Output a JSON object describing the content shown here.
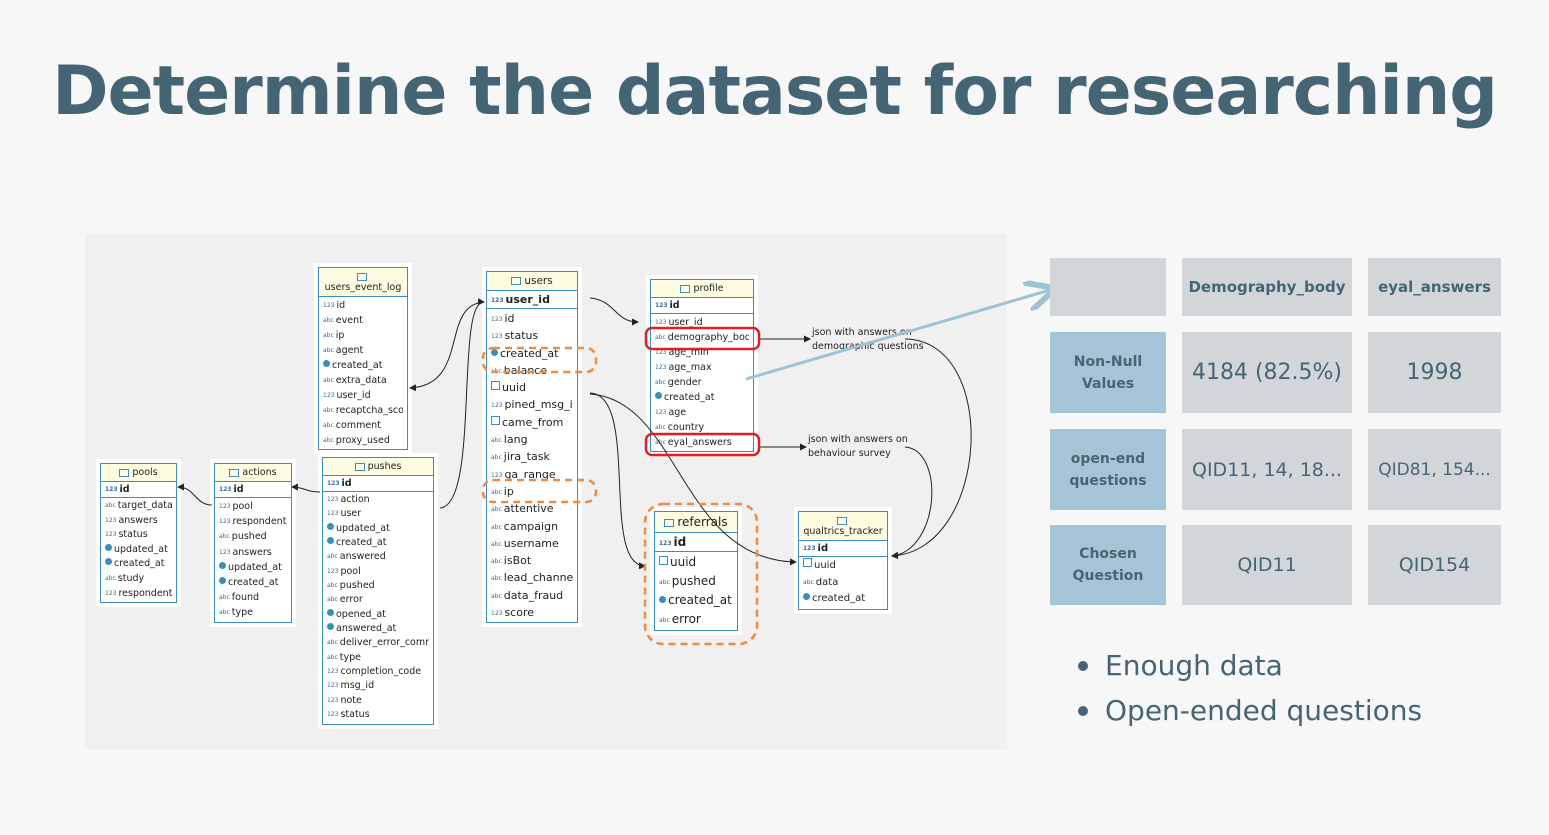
{
  "title": "Determine the dataset for researching",
  "diagram": {
    "tables": {
      "users_event_log": {
        "name": "users_event_log",
        "fields": [
          "id",
          "event",
          "ip",
          "agent",
          "created_at",
          "extra_data",
          "user_id",
          "recaptcha_score",
          "comment",
          "proxy_used"
        ]
      },
      "users": {
        "name": "users",
        "pk": "user_id",
        "fields": [
          "id",
          "status",
          "created_at",
          "balance",
          "uuid",
          "pined_msg_id",
          "came_from",
          "lang",
          "jira_task",
          "ga_range",
          "ip",
          "attentive",
          "campaign",
          "username",
          "isBot",
          "lead_channel",
          "data_fraud",
          "score"
        ]
      },
      "profile": {
        "name": "profile",
        "pk": "id",
        "fields": [
          "user_id",
          "demography_body",
          "age_min",
          "age_max",
          "gender",
          "created_at",
          "age",
          "country",
          "eyal_answers"
        ]
      },
      "pools": {
        "name": "pools",
        "pk": "id",
        "fields": [
          "target_data",
          "answers",
          "status",
          "updated_at",
          "created_at",
          "study",
          "respondents"
        ]
      },
      "actions": {
        "name": "actions",
        "pk": "id",
        "fields": [
          "pool",
          "respondents",
          "pushed",
          "answers",
          "updated_at",
          "created_at",
          "found",
          "type"
        ]
      },
      "pushes": {
        "name": "pushes",
        "pk": "id",
        "fields": [
          "action",
          "user",
          "updated_at",
          "created_at",
          "answered",
          "pool",
          "pushed",
          "error",
          "opened_at",
          "answered_at",
          "deliver_error_comment",
          "type",
          "completion_code",
          "msg_id",
          "note",
          "status"
        ]
      },
      "referrals": {
        "name": "referrals",
        "pk": "id",
        "fields": [
          "uuid",
          "pushed",
          "created_at",
          "error"
        ]
      },
      "qualtrics_tracker": {
        "name": "qualtrics_tracker",
        "pk": "id",
        "fields": [
          "uuid",
          "data",
          "created_at"
        ]
      }
    },
    "annotations": {
      "demography": "json with answers on\ndemographic questions",
      "behaviour": "json with answers on\nbehaviour survey"
    }
  },
  "table": {
    "headers": [
      "",
      "Demography_body",
      "eyal_answers"
    ],
    "rows": [
      {
        "label": "Non-Null\nValues",
        "values": [
          "4184 (82.5%)",
          "1998"
        ]
      },
      {
        "label": "open-end\nquestions",
        "values": [
          "QID11, 14, 18...",
          "QID81, 154..."
        ]
      },
      {
        "label": "Chosen\nQuestion",
        "values": [
          "QID11",
          "QID154"
        ]
      }
    ]
  },
  "bullets": [
    "Enough data",
    "Open-ended questions"
  ],
  "colors": {
    "title": "#466574",
    "table_header": "#d2d6d9",
    "row_header": "#a3c5d6",
    "er_border": "#3c8dbc",
    "highlight_red": "#e02020",
    "highlight_orange": "#f08a3c"
  }
}
